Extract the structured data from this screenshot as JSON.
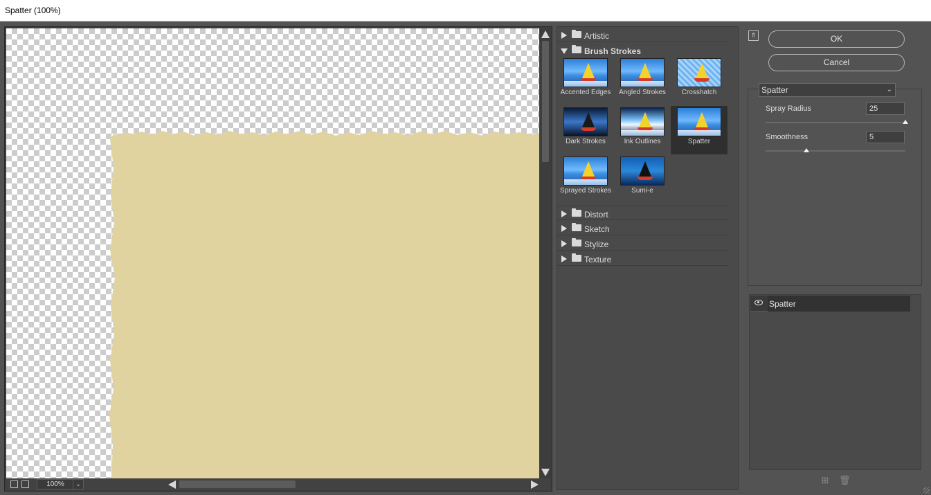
{
  "window": {
    "title": "Spatter (100%)"
  },
  "preview": {
    "zoom": "100%",
    "fill_color": "#e1d3a0"
  },
  "gallery": {
    "categories": [
      {
        "label": "Artistic",
        "expanded": false
      },
      {
        "label": "Brush Strokes",
        "expanded": true
      },
      {
        "label": "Distort",
        "expanded": false
      },
      {
        "label": "Sketch",
        "expanded": false
      },
      {
        "label": "Stylize",
        "expanded": false
      },
      {
        "label": "Texture",
        "expanded": false
      }
    ],
    "brush_strokes": [
      {
        "label": "Accented Edges"
      },
      {
        "label": "Angled Strokes"
      },
      {
        "label": "Crosshatch"
      },
      {
        "label": "Dark Strokes"
      },
      {
        "label": "Ink Outlines"
      },
      {
        "label": "Spatter",
        "selected": true
      },
      {
        "label": "Sprayed Strokes"
      },
      {
        "label": "Sumi-e"
      }
    ]
  },
  "buttons": {
    "ok": "OK",
    "cancel": "Cancel"
  },
  "settings": {
    "filter": "Spatter",
    "params": [
      {
        "label": "Spray Radius",
        "value": "25",
        "fraction": 1.0
      },
      {
        "label": "Smoothness",
        "value": "5",
        "fraction": 0.29
      }
    ]
  },
  "layers": {
    "items": [
      {
        "label": "Spatter"
      }
    ]
  }
}
